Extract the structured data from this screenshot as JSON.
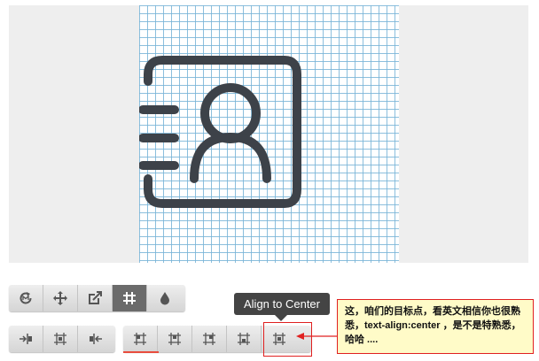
{
  "toolbar_row1": [
    {
      "name": "rotate-button",
      "icon": "rotate-icon",
      "active": false
    },
    {
      "name": "move-button",
      "icon": "move-icon",
      "active": false
    },
    {
      "name": "edit-button",
      "icon": "edit-resize-icon",
      "active": false
    },
    {
      "name": "grid-button",
      "icon": "grid-hash-icon",
      "active": true
    },
    {
      "name": "color-button",
      "icon": "droplet-icon",
      "active": false
    }
  ],
  "toolbar_row2_left": [
    {
      "name": "align-left-button",
      "icon": "align-left-icon"
    },
    {
      "name": "align-horizontal-center-button",
      "icon": "align-horizontal-center-icon"
    },
    {
      "name": "align-right-button",
      "icon": "align-right-icon"
    }
  ],
  "toolbar_row2_right": [
    {
      "name": "align-top-left-button",
      "icon": "align-top-left-icon"
    },
    {
      "name": "align-top-button",
      "icon": "align-top-icon"
    },
    {
      "name": "align-top-right-button",
      "icon": "align-top-right-icon"
    },
    {
      "name": "align-bottom-button",
      "icon": "align-bottom-icon"
    },
    {
      "name": "align-to-center-button",
      "icon": "align-center-icon"
    }
  ],
  "tooltip": {
    "text": "Align to Center"
  },
  "callout": {
    "text": "这，咱们的目标点，看英文相信你也很熟悉，text-align:center ，是不是特熟悉，哈哈 ...."
  },
  "preview": {
    "icon": "contact-card-icon",
    "icon_color": "#3d4249"
  },
  "colors": {
    "accent_red": "#e02020",
    "active_button": "#6b6b6b",
    "grid_line": "#78b4d7"
  }
}
